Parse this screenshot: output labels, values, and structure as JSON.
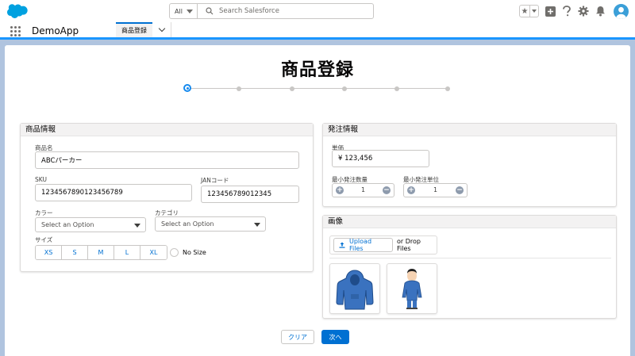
{
  "header": {
    "search_scope": "All",
    "search_placeholder": "Search Salesforce",
    "icons": [
      "salesforce-cloud-icon",
      "favorites-star-icon",
      "global-add-icon",
      "help-icon",
      "setup-gear-icon",
      "notifications-bell-icon",
      "user-avatar-icon"
    ]
  },
  "nav": {
    "app_name": "DemoApp",
    "tab_label": "商品登録"
  },
  "page": {
    "title": "商品登録",
    "path_steps_total": 6,
    "path_active_step": 1
  },
  "product": {
    "header": "商品情報",
    "name_label": "商品名",
    "name_value": "ABCパーカー",
    "sku_label": "SKU",
    "sku_value": "1234567890123456789",
    "jan_label": "JANコード",
    "jan_value": "123456789012345",
    "color_label": "カラー",
    "color_placeholder": "Select an Option",
    "category_label": "カテゴリ",
    "category_placeholder": "Select an Option",
    "size_label": "サイズ",
    "sizes": [
      "XS",
      "S",
      "M",
      "L",
      "XL"
    ],
    "no_size_label": "No Size"
  },
  "order": {
    "header": "発注情報",
    "price_label": "単価",
    "price_value": "¥ 123,456",
    "min_qty_label": "最小発注数量",
    "min_qty_value": "1",
    "min_unit_label": "最小発注単位",
    "min_unit_value": "1"
  },
  "images": {
    "header": "画像",
    "upload_label": "Upload Files",
    "drop_label": "or Drop Files",
    "thumbnails": [
      "hoodie-thumbnail",
      "person-in-hoodie-thumbnail"
    ]
  },
  "actions": {
    "clear_label": "クリア",
    "next_label": "次へ"
  },
  "colors": {
    "brand": "#0070d2",
    "hoodie": "#3a72bf"
  }
}
